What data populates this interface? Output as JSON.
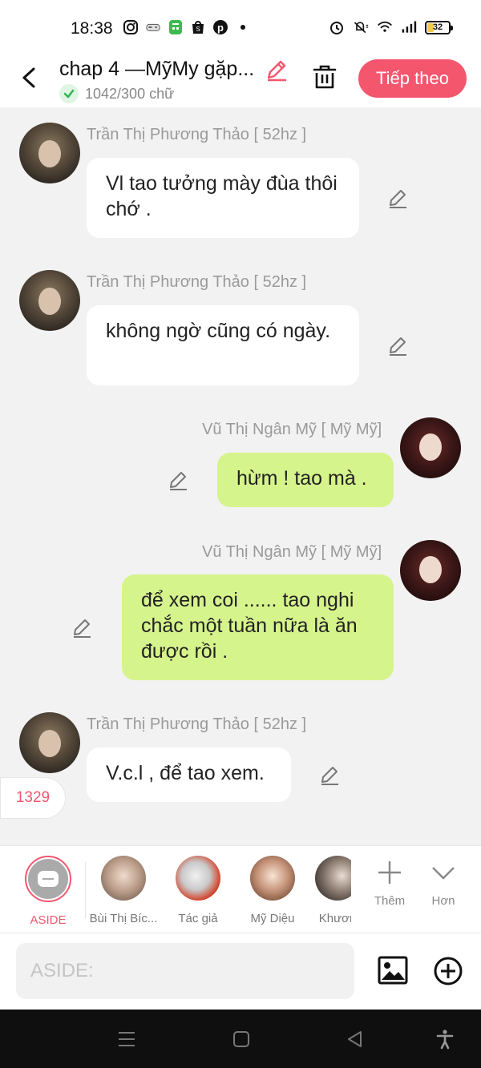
{
  "status_bar": {
    "time": "18:38",
    "battery": "32",
    "icons_left": [
      "instagram-icon",
      "game-controller-icon",
      "calculator-app-icon",
      "shopping-bag-icon",
      "pinterest-icon",
      "dot-icon"
    ],
    "icons_right": [
      "alarm-icon",
      "mute-icon",
      "wifi-icon",
      "signal-icon",
      "battery-icon"
    ]
  },
  "header": {
    "title": "chap 4 —MỹMy gặp...",
    "word_count": "1042/300 chữ",
    "next_label": "Tiếp theo",
    "accent_color": "#f4566e"
  },
  "messages": [
    {
      "sender": "Trần Thị Phương Thảo [ 52hz ]",
      "text": "Vl tao tưởng mày đùa thôi chớ .",
      "side": "left"
    },
    {
      "sender": "Trần Thị Phương Thảo [ 52hz ]",
      "text": "không ngờ cũng có ngày.",
      "side": "left"
    },
    {
      "sender": "Vũ Thị Ngân Mỹ [ Mỹ Mỹ]",
      "text": "hừm ! tao mà .",
      "side": "right"
    },
    {
      "sender": "Vũ Thị Ngân Mỹ [ Mỹ Mỹ]",
      "text": "để xem coi ...... tao nghi chắc một tuần nữa là ăn được rồi .",
      "side": "right"
    },
    {
      "sender": "Trần Thị Phương Thảo [ 52hz ]",
      "text": "V.c.l , để tao xem.",
      "side": "left"
    }
  ],
  "count_badge": "1329",
  "characters": [
    {
      "label": "ASIDE"
    },
    {
      "label": "Bùi Thị Bíc..."
    },
    {
      "label": "Tác giả"
    },
    {
      "label": "Mỹ Diệu"
    },
    {
      "label": "Khươn"
    }
  ],
  "tools": {
    "more_label": "Thêm",
    "expand_label": "Hơn"
  },
  "input": {
    "placeholder": "ASIDE:"
  },
  "colors": {
    "bubble_green": "#d6f48c",
    "bubble_white": "#ffffff",
    "sender_gray": "#9a9a9a"
  }
}
